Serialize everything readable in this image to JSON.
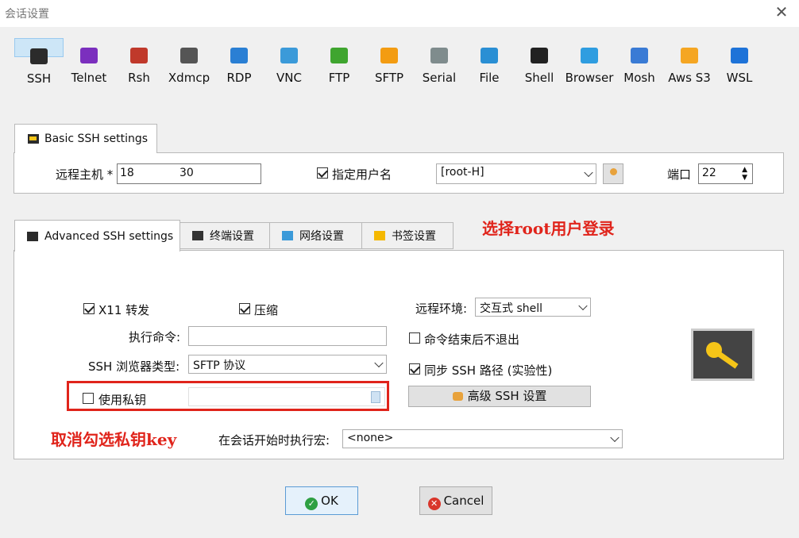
{
  "window": {
    "title": "会话设置",
    "close_glyph": "✕"
  },
  "protocols": [
    {
      "label": "SSH",
      "icon": "ssh-key-icon",
      "color": "#2b2b2b"
    },
    {
      "label": "Telnet",
      "icon": "telnet-icon",
      "color": "#7b2fbe"
    },
    {
      "label": "Rsh",
      "icon": "rsh-icon",
      "color": "#c0392b"
    },
    {
      "label": "Xdmcp",
      "icon": "xdmcp-icon",
      "color": "#555555"
    },
    {
      "label": "RDP",
      "icon": "rdp-monitor-icon",
      "color": "#2a7fd4"
    },
    {
      "label": "VNC",
      "icon": "vnc-icon",
      "color": "#3b9ad9"
    },
    {
      "label": "FTP",
      "icon": "ftp-globe-icon",
      "color": "#3fa52f"
    },
    {
      "label": "SFTP",
      "icon": "sftp-globe-icon",
      "color": "#f39c12"
    },
    {
      "label": "Serial",
      "icon": "serial-plug-icon",
      "color": "#7f8c8d"
    },
    {
      "label": "File",
      "icon": "file-monitor-icon",
      "color": "#2a8fd4"
    },
    {
      "label": "Shell",
      "icon": "shell-terminal-icon",
      "color": "#222222"
    },
    {
      "label": "Browser",
      "icon": "browser-globe-icon",
      "color": "#2f9de0"
    },
    {
      "label": "Mosh",
      "icon": "mosh-satellite-icon",
      "color": "#3a7bd5"
    },
    {
      "label": "Aws S3",
      "icon": "aws-s3-cubes-icon",
      "color": "#f5a623"
    },
    {
      "label": "WSL",
      "icon": "wsl-windows-icon",
      "color": "#1e73d8"
    }
  ],
  "basic": {
    "tab_label": "Basic SSH settings",
    "host_label": "远程主机 *",
    "host_value_a": "18.",
    "host_value_b": "30",
    "user_cb_label": "指定用户名",
    "user_value": "[root-H]",
    "port_label": "端口",
    "port_value": "22"
  },
  "annotation_user": "选择root用户登录",
  "annotation_key": "取消勾选私钥key",
  "adv_tabs": [
    {
      "label": "Advanced SSH settings",
      "icon": "ssh-key-icon"
    },
    {
      "label": "终端设置",
      "icon": "terminal-settings-icon"
    },
    {
      "label": "网络设置",
      "icon": "network-settings-icon"
    },
    {
      "label": "书签设置",
      "icon": "bookmark-star-icon"
    }
  ],
  "advanced": {
    "x11_label": "X11 转发",
    "compress_label": "压缩",
    "remote_env_label": "远程环境:",
    "remote_env_value": "交互式 shell",
    "exec_cmd_label": "执行命令:",
    "exec_cmd_value": "",
    "no_exit_label": "命令结束后不退出",
    "browser_type_label": "SSH 浏览器类型:",
    "browser_type_value": "SFTP 协议",
    "sync_path_label": "同步 SSH 路径 (实验性)",
    "private_key_label": "使用私钥",
    "private_key_value": "",
    "adv_btn_label": "高级 SSH 设置",
    "macro_label": "在会话开始时执行宏:",
    "macro_value": "<none>",
    "x11_checked": true,
    "compress_checked": true,
    "no_exit_checked": false,
    "sync_path_checked": true,
    "private_key_checked": false
  },
  "buttons": {
    "ok": "OK",
    "cancel": "Cancel"
  },
  "colors": {
    "accent": "#cde6f7",
    "annotation": "#e0241b",
    "ok_green": "#2ea043",
    "cancel_red": "#d9362b"
  }
}
